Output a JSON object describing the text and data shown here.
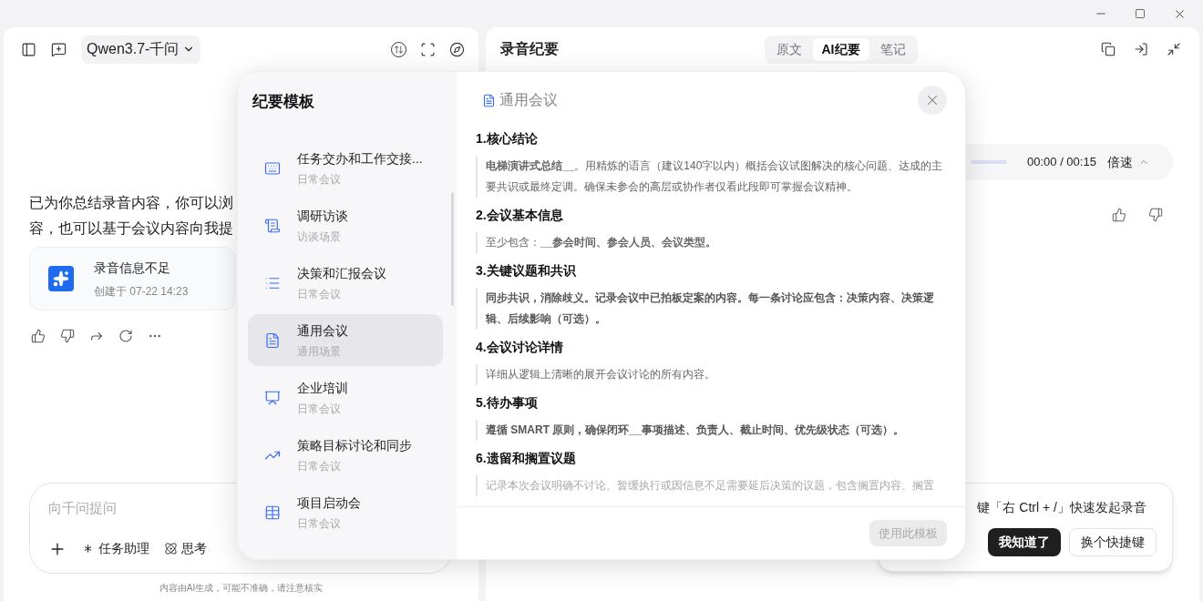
{
  "chat": {
    "model": "Qwen3.7-千问",
    "message_lines": [
      "已为你总结录音内容，你可以浏",
      "容，也可以基于会议内容向我提"
    ],
    "card": {
      "title": "录音信息不足",
      "created": "创建于 07-22 14:23"
    },
    "input": {
      "placeholder": "向千问提问",
      "tools": [
        {
          "label": "任务助理",
          "kind": "task"
        },
        {
          "label": "思考",
          "kind": "think"
        }
      ]
    },
    "disclaimer": "内容由AI生成，可能不准确，请注意核实"
  },
  "summary": {
    "title": "录音纪要",
    "tabs": [
      {
        "label": "原文",
        "selected": false
      },
      {
        "label": "AI纪要",
        "selected": true
      },
      {
        "label": "笔记",
        "selected": false
      }
    ],
    "player": {
      "level": 0,
      "time": "00:00 / 00:15",
      "speed": "倍速"
    },
    "tip": {
      "text": "键「右 Ctrl + /」快速发起录音",
      "buttons": [
        {
          "label": "我知道了",
          "kind": "primary"
        },
        {
          "label": "换个快捷键",
          "kind": "secondary"
        }
      ]
    }
  },
  "template_dialog": {
    "title": "纪要模板",
    "templates": [
      {
        "name": "任务交办和工作交接...",
        "category": "日常会议",
        "kind": "keyboard",
        "selected": false
      },
      {
        "name": "调研访谈",
        "category": "访谈场景",
        "kind": "scroll",
        "selected": false
      },
      {
        "name": "决策和汇报会议",
        "category": "日常会议",
        "kind": "list",
        "selected": false
      },
      {
        "name": "通用会议",
        "category": "通用场景",
        "kind": "document",
        "selected": true
      },
      {
        "name": "企业培训",
        "category": "日常会议",
        "kind": "presentation",
        "selected": false
      },
      {
        "name": "策略目标讨论和同步",
        "category": "日常会议",
        "kind": "trend",
        "selected": false
      },
      {
        "name": "项目启动会",
        "category": "日常会议",
        "kind": "table",
        "selected": false
      }
    ],
    "preview": {
      "title": "通用会议",
      "sections": [
        {
          "heading": "1.核心结论",
          "body": "**电梯演讲式总结__**。用精炼的语言（建议140字以内）概括会议试图解决的核心问题、达成的主要共识或最终定调。确保未参会的高层或协作者仅看此段即可掌握会议精神。",
          "bold": false,
          "faded": false
        },
        {
          "heading": "2.会议基本信息",
          "body": "至少包含：**__参会时间、参会人员、会议类型。**",
          "bold": false,
          "faded": false
        },
        {
          "heading": "3.关键议题和共识",
          "body": "同步共识，消除歧义。记录会议中已拍板定案的内容。每一条讨论应包含：决策内容、决策逻辑、后续影响（可选）。",
          "bold": true,
          "faded": false
        },
        {
          "heading": "4.会议讨论详情",
          "body": "详细从逻辑上清晰的展开会议讨论的所有内容。",
          "bold": false,
          "faded": false
        },
        {
          "heading": "5.待办事项",
          "body": "遵循 SMART 原则，确保闭环__事项描述、负责人、截止时间、优先级状态（可选）。",
          "bold": true,
          "faded": false
        },
        {
          "heading": "6.遗留和搁置议题",
          "body": "记录本次会议明确不讨论、暂缓执行或因信息不足需要延后决策的议题，包含搁置内容、搁置",
          "bold": false,
          "faded": true
        }
      ],
      "apply_button": {
        "label": "使用此模板",
        "disabled": true
      }
    }
  }
}
